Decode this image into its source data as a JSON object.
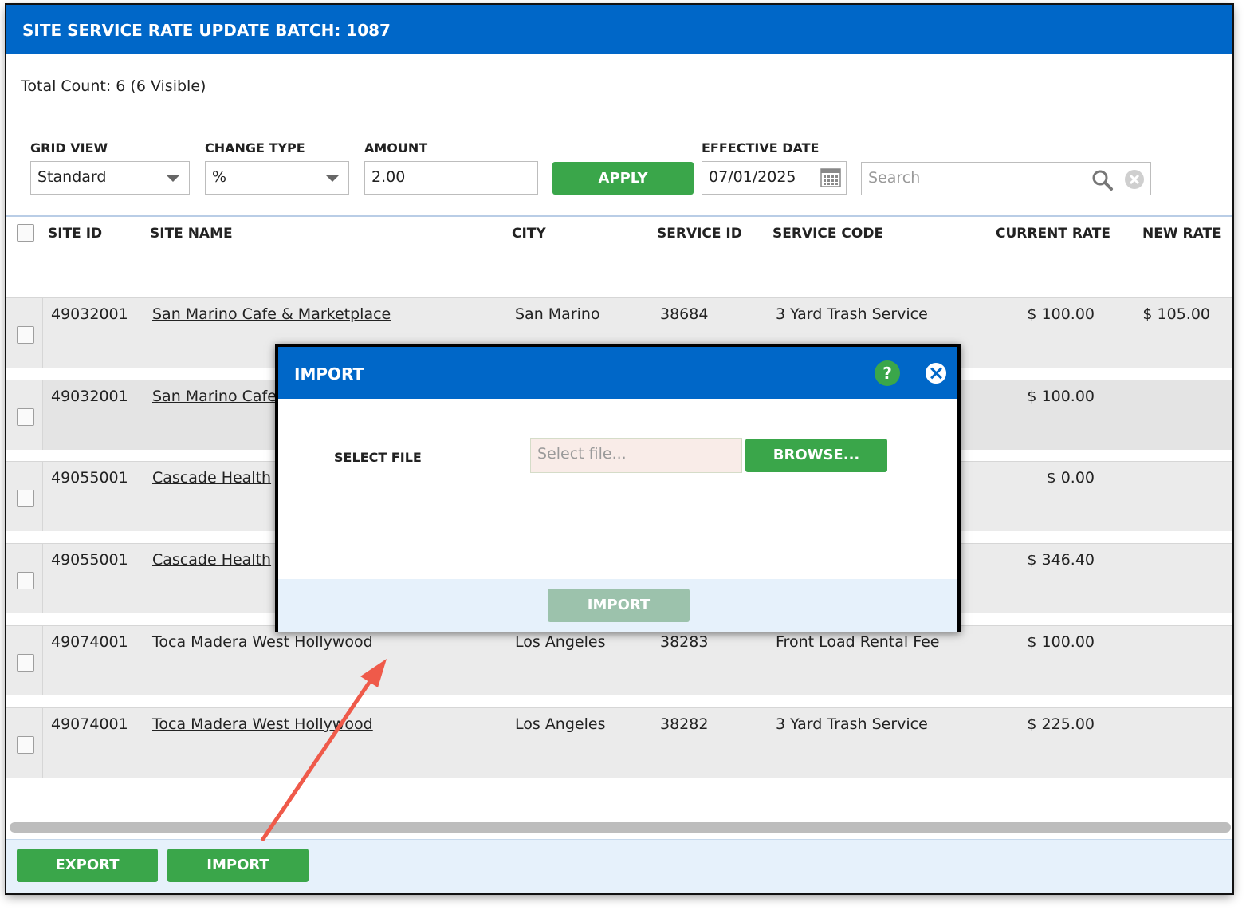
{
  "window": {
    "title": "SITE SERVICE RATE UPDATE BATCH: 1087"
  },
  "summary": {
    "total_count": "Total Count: 6 (6 Visible)"
  },
  "filters": {
    "grid_view": {
      "label": "GRID VIEW",
      "value": "Standard"
    },
    "change_type": {
      "label": "CHANGE TYPE",
      "value": "%"
    },
    "amount": {
      "label": "AMOUNT",
      "value": "2.00"
    },
    "apply_label": "APPLY",
    "effective_date": {
      "label": "EFFECTIVE DATE",
      "value": "07/01/2025"
    },
    "search": {
      "placeholder": "Search"
    }
  },
  "grid": {
    "columns": [
      "SITE ID",
      "SITE NAME",
      "CITY",
      "SERVICE ID",
      "SERVICE CODE",
      "CURRENT RATE",
      "NEW RATE"
    ],
    "rows": [
      {
        "site_id": "49032001",
        "site_name": "San Marino Cafe & Marketplace",
        "city": "San Marino",
        "service_id": "38684",
        "service_code": "3 Yard Trash Service",
        "current_rate": "$ 100.00",
        "new_rate": "$ 105.00"
      },
      {
        "site_id": "49032001",
        "site_name": "San Marino Cafe",
        "city": "",
        "service_id": "",
        "service_code": "",
        "current_rate": "$ 100.00",
        "new_rate": ""
      },
      {
        "site_id": "49055001",
        "site_name": "Cascade Health",
        "city": "",
        "service_id": "",
        "service_code": "",
        "current_rate": "$ 0.00",
        "new_rate": ""
      },
      {
        "site_id": "49055001",
        "site_name": "Cascade Health",
        "city": "",
        "service_id": "",
        "service_code": "",
        "current_rate": "$ 346.40",
        "new_rate": ""
      },
      {
        "site_id": "49074001",
        "site_name": "Toca Madera West Hollywood",
        "city": "Los Angeles",
        "service_id": "38283",
        "service_code": "Front Load Rental Fee",
        "current_rate": "$ 100.00",
        "new_rate": ""
      },
      {
        "site_id": "49074001",
        "site_name": "Toca Madera West Hollywood",
        "city": "Los Angeles",
        "service_id": "38282",
        "service_code": "3 Yard Trash Service",
        "current_rate": "$ 225.00",
        "new_rate": ""
      }
    ]
  },
  "footer": {
    "export_label": "EXPORT",
    "import_label": "IMPORT"
  },
  "modal": {
    "title": "IMPORT",
    "help_glyph": "?",
    "select_file_label": "SELECT FILE",
    "file_placeholder": "Select file...",
    "browse_label": "BROWSE...",
    "import_label": "IMPORT"
  },
  "colors": {
    "header_blue": "#0067c8",
    "button_green": "#3aa64a",
    "disabled_green": "#9cc2ac",
    "annotation_arrow": "#ef5a4a"
  }
}
